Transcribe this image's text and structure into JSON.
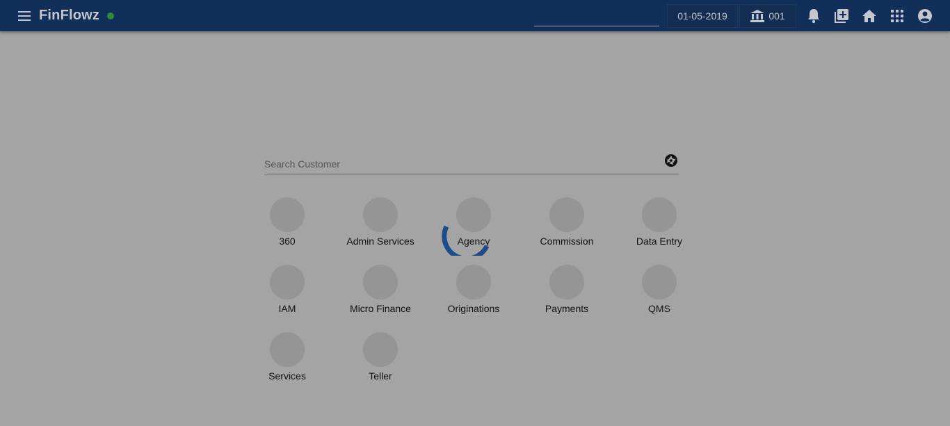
{
  "header": {
    "brand": "FinFlowz",
    "status_color": "#2f8b36",
    "search_value": "",
    "date": "01-05-2019",
    "branch": "001",
    "icons": [
      "menu-icon",
      "bank-icon",
      "bell-icon",
      "add-box-icon",
      "home-icon",
      "apps-grid-icon",
      "account-circle-icon"
    ]
  },
  "main": {
    "search_placeholder": "Search Customer",
    "search_icon": "aperture-icon",
    "modules": [
      {
        "label": "360"
      },
      {
        "label": "Admin Services"
      },
      {
        "label": "Agency"
      },
      {
        "label": "Commission"
      },
      {
        "label": "Data Entry"
      },
      {
        "label": "IAM"
      },
      {
        "label": "Micro Finance"
      },
      {
        "label": "Originations"
      },
      {
        "label": "Payments"
      },
      {
        "label": "QMS"
      },
      {
        "label": "Services"
      },
      {
        "label": "Teller"
      }
    ]
  },
  "overlay": {
    "loading_spinner_color": "#1e4b8a"
  },
  "colors": {
    "header_bg": "#122f59",
    "page_bg": "#a4a4a4",
    "tile_circle": "#959595"
  }
}
